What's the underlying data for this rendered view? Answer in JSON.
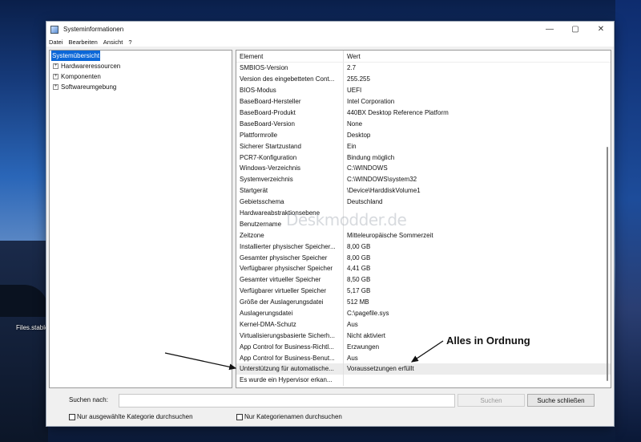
{
  "desktop": {
    "icon_label": "Files.stable"
  },
  "window": {
    "title": "Systeminformationen",
    "controls": {
      "minimize": "—",
      "maximize": "▢",
      "close": "✕"
    }
  },
  "menu": [
    "Datei",
    "Bearbeiten",
    "Ansicht",
    "?"
  ],
  "tree": {
    "root": "Systemübersicht",
    "children": [
      "Hardwareressourcen",
      "Komponenten",
      "Softwareumgebung"
    ]
  },
  "table": {
    "columns": [
      "Element",
      "Wert"
    ],
    "rows": [
      [
        "SMBIOS-Version",
        "2.7"
      ],
      [
        "Version des eingebetteten Cont...",
        "255.255"
      ],
      [
        "BIOS-Modus",
        "UEFI"
      ],
      [
        "BaseBoard-Hersteller",
        "Intel Corporation"
      ],
      [
        "BaseBoard-Produkt",
        "440BX Desktop Reference Platform"
      ],
      [
        "BaseBoard-Version",
        "None"
      ],
      [
        "Plattformrolle",
        "Desktop"
      ],
      [
        "Sicherer Startzustand",
        "Ein"
      ],
      [
        "PCR7-Konfiguration",
        "Bindung möglich"
      ],
      [
        "Windows-Verzeichnis",
        "C:\\WINDOWS"
      ],
      [
        "Systemverzeichnis",
        "C:\\WINDOWS\\system32"
      ],
      [
        "Startgerät",
        "\\Device\\HarddiskVolume1"
      ],
      [
        "Gebietsschema",
        "Deutschland"
      ],
      [
        "Hardwareabstraktionsebene",
        ""
      ],
      [
        "Benutzername",
        ""
      ],
      [
        "Zeitzone",
        "Mitteleuropäische Sommerzeit"
      ],
      [
        "Installierter physischer Speicher...",
        "8,00 GB"
      ],
      [
        "Gesamter physischer Speicher",
        "8,00 GB"
      ],
      [
        "Verfügbarer physischer Speicher",
        "4,41 GB"
      ],
      [
        "Gesamter virtueller Speicher",
        "8,50 GB"
      ],
      [
        "Verfügbarer virtueller Speicher",
        "5,17 GB"
      ],
      [
        "Größe der Auslagerungsdatei",
        "512 MB"
      ],
      [
        "Auslagerungsdatei",
        "C:\\pagefile.sys"
      ],
      [
        "Kernel-DMA-Schutz",
        "Aus"
      ],
      [
        "Virtualisierungsbasierte Sicherh...",
        "Nicht aktiviert"
      ],
      [
        "App Control for Business-Richtl...",
        "Erzwungen"
      ],
      [
        "App Control for Business-Benut...",
        "Aus"
      ],
      [
        "Unterstützung für automatische...",
        "Voraussetzungen erfüllt"
      ],
      [
        "Es wurde ein Hypervisor erkan...",
        ""
      ]
    ],
    "highlighted_row": 27
  },
  "watermark": "Deskmodder.de",
  "search": {
    "label": "Suchen nach:",
    "value": "",
    "search_button": "Suchen",
    "close_button": "Suche schließen"
  },
  "options": {
    "selected_category": "Nur ausgewählte Kategorie durchsuchen",
    "category_names": "Nur Kategorienamen durchsuchen"
  },
  "annotation": {
    "text": "Alles in Ordnung"
  }
}
